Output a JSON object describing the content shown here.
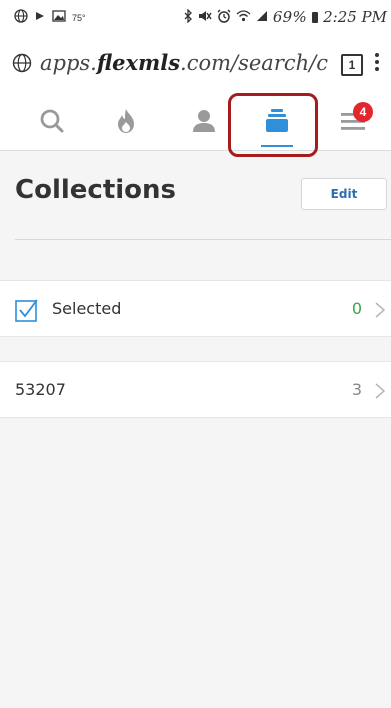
{
  "status_bar": {
    "temperature": "75°",
    "battery_percent": "69%",
    "time": "2:25 PM"
  },
  "url_bar": {
    "prefix": "apps.",
    "domain": "flexmls",
    "suffix": ".com/search/c",
    "tab_count": "1"
  },
  "nav": {
    "items": [
      {
        "name": "search",
        "icon": "search-icon"
      },
      {
        "name": "hot",
        "icon": "flame-icon"
      },
      {
        "name": "contacts",
        "icon": "person-icon"
      },
      {
        "name": "collections",
        "icon": "collections-icon",
        "active": true
      },
      {
        "name": "menu",
        "icon": "hamburger-menu-icon"
      }
    ],
    "menu_badge": "4",
    "accent_color": "#2f8fd8",
    "highlight_color": "#a61c1c"
  },
  "header": {
    "title": "Collections",
    "edit_label": "Edit"
  },
  "collections": [
    {
      "label": "Selected",
      "count": "0",
      "count_color": "#3aa54a",
      "icon": "checkbox-checked-icon"
    },
    {
      "label": "53207",
      "count": "3",
      "count_color": "#888888"
    }
  ]
}
